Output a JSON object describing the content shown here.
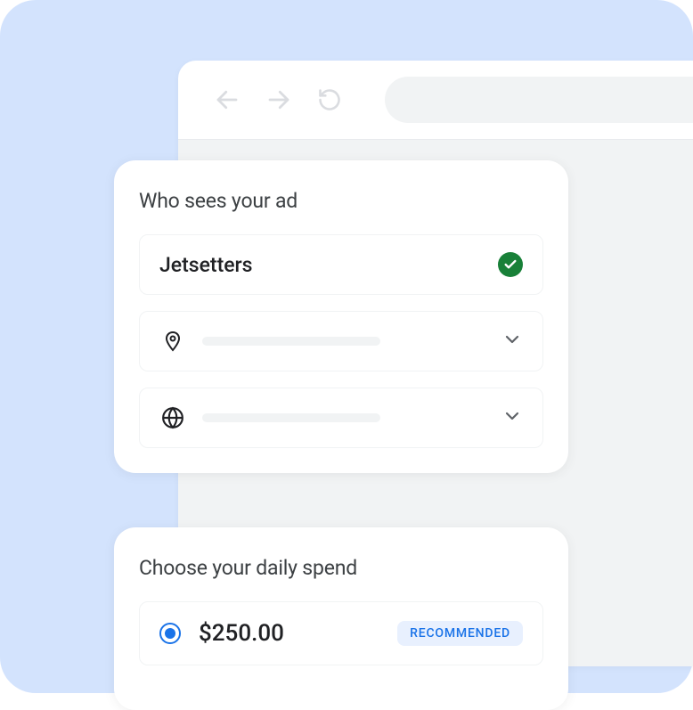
{
  "audience": {
    "title": "Who sees your ad",
    "selected_segment": "Jetsetters"
  },
  "spend": {
    "title": "Choose your daily spend",
    "amount": "$250.00",
    "badge": "RECOMMENDED"
  },
  "colors": {
    "backdrop": "#d3e3fd",
    "accent": "#1a73e8",
    "success": "#188038"
  }
}
